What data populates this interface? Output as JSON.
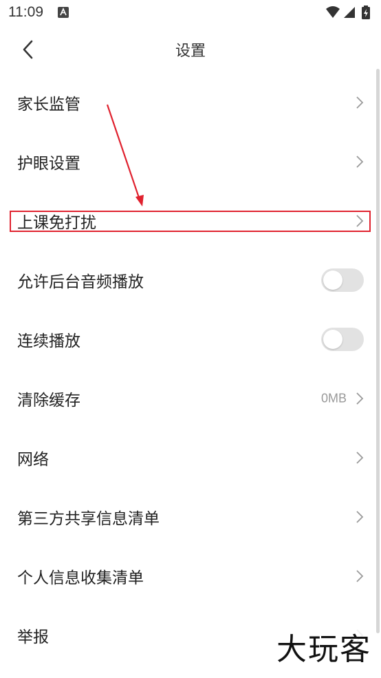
{
  "status_bar": {
    "time": "11:09",
    "icons": [
      "notification-a-icon",
      "wifi-icon",
      "signal-icon",
      "battery-charging-icon"
    ]
  },
  "nav": {
    "title": "设置",
    "back_icon": "chevron-left-icon"
  },
  "settings": {
    "items": [
      {
        "label": "家长监管",
        "control": "chevron"
      },
      {
        "label": "护眼设置",
        "control": "chevron"
      },
      {
        "label": "上课免打扰",
        "control": "chevron",
        "highlighted": true
      },
      {
        "label": "允许后台音频播放",
        "control": "toggle",
        "checked": false
      },
      {
        "label": "连续播放",
        "control": "toggle",
        "checked": false
      },
      {
        "label": "清除缓存",
        "control": "chevron",
        "value": "0MB"
      },
      {
        "label": "网络",
        "control": "chevron"
      },
      {
        "label": "第三方共享信息清单",
        "control": "chevron"
      },
      {
        "label": "个人信息收集清单",
        "control": "chevron"
      },
      {
        "label": "举报",
        "control": "chevron"
      }
    ]
  },
  "annotation": {
    "color": "#e0212e"
  },
  "watermark": {
    "text": "大玩客"
  }
}
